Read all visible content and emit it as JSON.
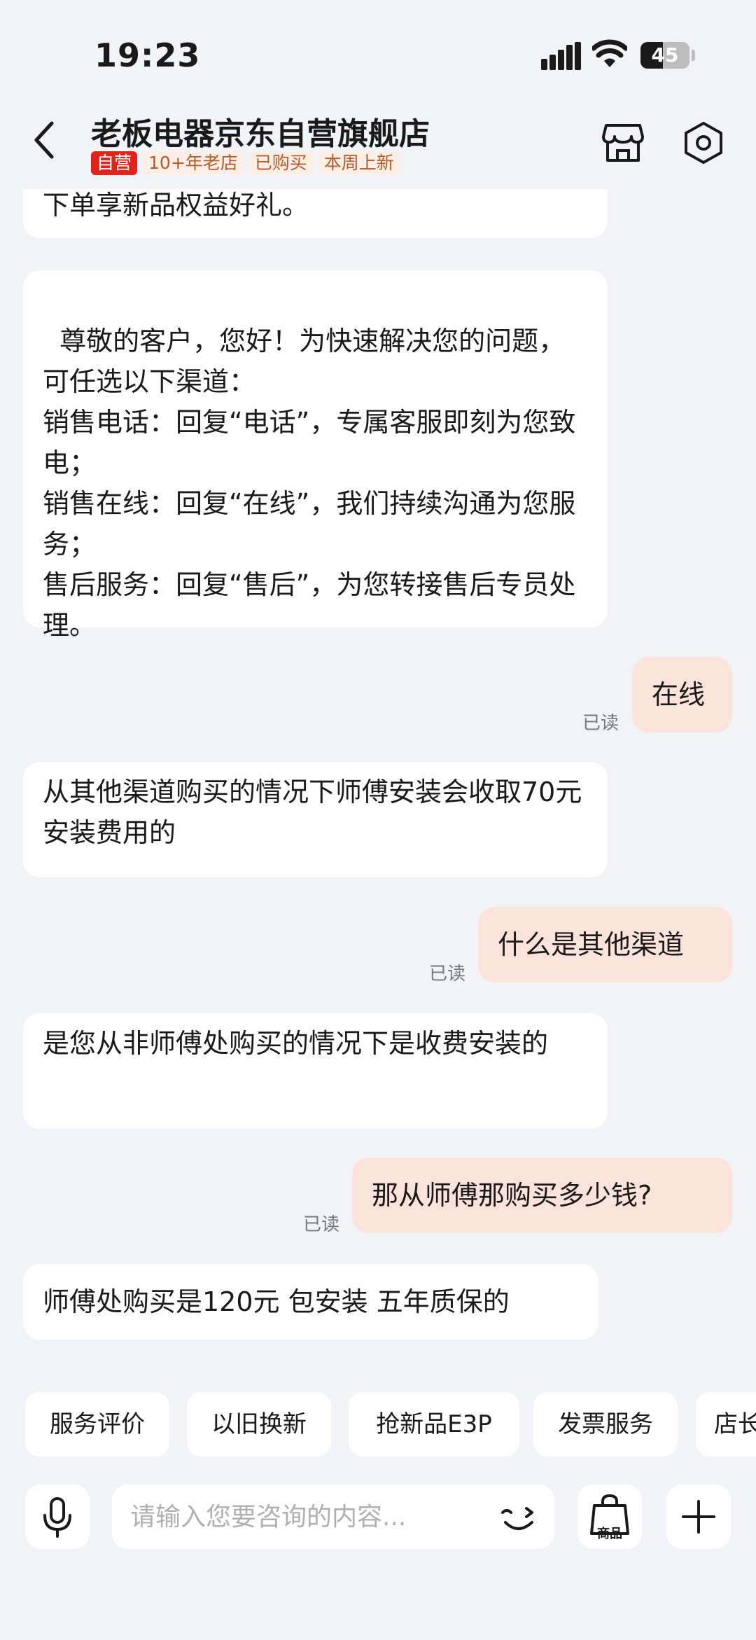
{
  "status_bar": {
    "time": "19:23",
    "battery": "45",
    "battery_level": 0.45
  },
  "header": {
    "title": "老板电器京东自营旗舰店",
    "tags": [
      "自营",
      "10+年老店",
      "已购买",
      "本周上新"
    ]
  },
  "messages": {
    "m0": "下单享新品权益好礼。",
    "m1": "尊敬的客户，您好！为快速解决您的问题，可任选以下渠道：\n销售电话：回复“电话”，专属客服即刻为您致电；\n销售在线：回复“在线”，我们持续沟通为您服务；\n售后服务：回复“售后”，为您转接售后专员处理。",
    "m2": "在线",
    "m3": "从其他渠道购买的情况下师傅安装会收取70元安装费用的",
    "m4": "什么是其他渠道",
    "m5": "是您从非师傅处购买的情况下是收费安装的",
    "m6": "那从师傅那购买多少钱?",
    "m7": "师傅处购买是120元 包安装 五年质保的"
  },
  "read_label": "已读",
  "quick_actions": [
    "服务评价",
    "以旧换新",
    "抢新品E3P",
    "发票服务",
    "店长"
  ],
  "input": {
    "placeholder": "请输入您要咨询的内容...",
    "value": ""
  },
  "goods_label": "商品",
  "icons": [
    "back-icon",
    "store-icon",
    "settings-icon",
    "microphone-icon",
    "emoji-icon",
    "goods-bag-icon",
    "plus-icon"
  ]
}
